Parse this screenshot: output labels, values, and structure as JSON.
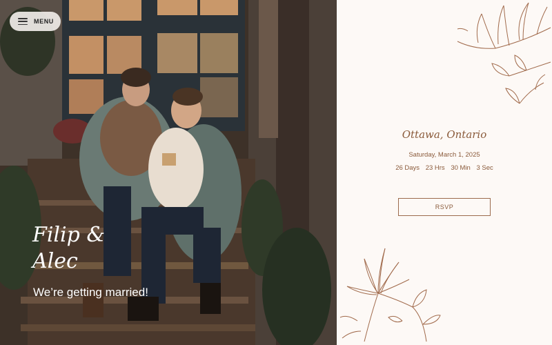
{
  "menu": {
    "label": "MENU"
  },
  "hero": {
    "name_line1": "Filip &",
    "name_line2": "Alec",
    "tagline": "We’re getting married!"
  },
  "event": {
    "location": "Ottawa, Ontario",
    "date": "Saturday, March 1, 2025",
    "countdown": {
      "days": "26 Days",
      "hours": "23 Hrs",
      "minutes": "30 Min",
      "seconds": "3 Sec"
    },
    "rsvp_label": "RSVP"
  },
  "colors": {
    "accent": "#8a5a3a",
    "background": "#fdf9f6",
    "botanical": "#a0694a"
  }
}
